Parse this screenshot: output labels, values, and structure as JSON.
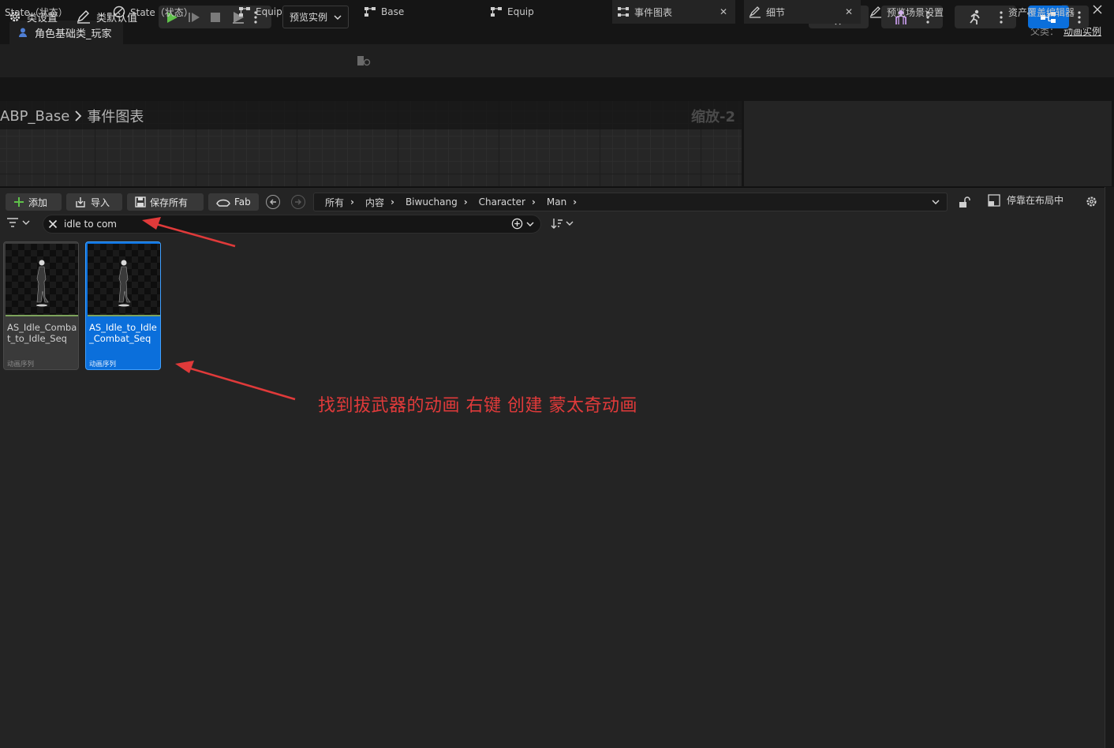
{
  "title_bar": {
    "tab_title": "角色基础类_玩家",
    "parent_label": "父类：",
    "parent_value": "动画实例"
  },
  "toolbar": {
    "class_settings": "类设置",
    "class_defaults": "类默认值",
    "preview_instance": "预览实例"
  },
  "tabs": [
    {
      "label": "State（状态）",
      "icon": "graph-icon"
    },
    {
      "label": "State（状态）",
      "icon": "state-machine-icon"
    },
    {
      "label": "Equip",
      "icon": "graph-icon"
    },
    {
      "label": "Base",
      "icon": "graph-icon"
    },
    {
      "label": "Equip",
      "icon": "graph-icon"
    },
    {
      "label": "事件图表",
      "icon": "event-graph-icon",
      "active": true
    },
    {
      "label": "细节",
      "icon": "details-icon",
      "active": true
    },
    {
      "label": "预览场景设置",
      "icon": "scene-icon"
    },
    {
      "label": "资产覆盖编辑器",
      "icon": ""
    }
  ],
  "graph": {
    "path_root": "ABP_Base",
    "path_leaf": "事件图表",
    "zoom_label": "缩放-2"
  },
  "content_browser": {
    "add_label": "添加",
    "import_label": "导入",
    "save_all_label": "保存所有",
    "fab_label": "Fab",
    "path": [
      "所有",
      "内容",
      "Biwuchang",
      "Character",
      "Man"
    ],
    "dock_label": "停靠在布局中",
    "search_value": "idle to com",
    "assets": [
      {
        "name": "AS_Idle_Combat_to_Idle_Seq",
        "type": "动画序列",
        "selected": false
      },
      {
        "name": "AS_Idle_to_Idle_Combat_Seq",
        "type": "动画序列",
        "selected": true
      }
    ]
  },
  "annotation": {
    "text": "找到拔武器的动画 右键 创建 蒙太奇动画",
    "color": "#e03a3a"
  },
  "colors": {
    "accent_blue": "#0b6fdb",
    "play_green": "#5fc24a",
    "anim_sequence_bar": "#7da35c"
  }
}
